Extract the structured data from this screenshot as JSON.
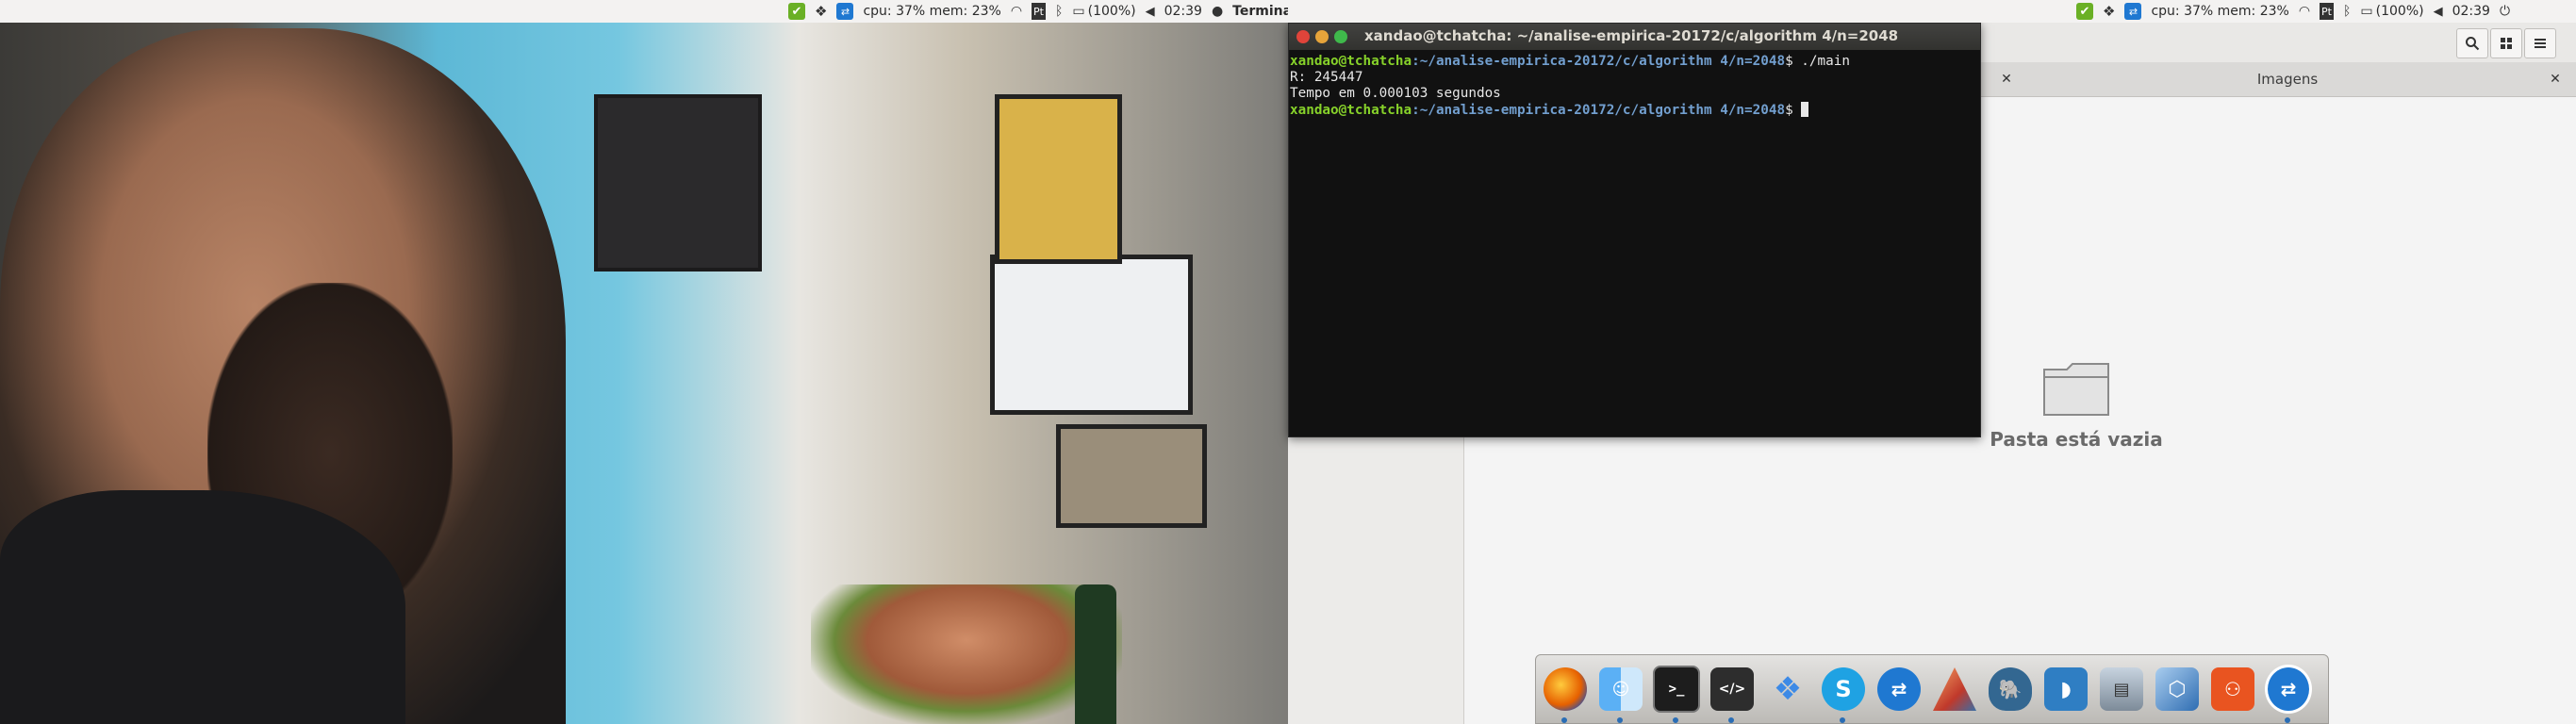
{
  "top_panel": {
    "cpu_mem": "cpu: 37% mem: 23%",
    "keyboard_layout": "Pt",
    "battery": "(100%)",
    "clock": "02:39",
    "app_name": "Terminal"
  },
  "top_panel_right": {
    "cpu_mem": "cpu: 37% mem: 23%",
    "keyboard_layout": "Pt",
    "battery": "(100%)",
    "clock": "02:39"
  },
  "terminal": {
    "title": "xandao@tchatcha: ~/analise-empirica-20172/c/algorithm 4/n=2048",
    "prompt_user": "xandao@tchatcha",
    "prompt_path": ":~/analise-empirica-20172/c/algorithm 4/n=2048",
    "prompt_suffix": "$ ",
    "command": "./main",
    "output_1": "R: 245447",
    "output_2": "Tempo em 0.000103 segundos",
    "prompt2_user": "xandao@tchatcha",
    "prompt2_path": ":~/analise-empirica-20172/c/algorithm 4/n=2048",
    "prompt2_suffix": "$ "
  },
  "file_manager": {
    "tab_label": "Imagens",
    "empty_message": "Pasta está vazia"
  },
  "dock": {
    "items": [
      "firefox-icon",
      "finder-icon",
      "terminal-icon",
      "code-editor-icon",
      "dropbox-icon",
      "skype-icon",
      "teamviewer-icon",
      "matlab-icon",
      "postgresql-icon",
      "mysql-workbench-icon",
      "scanner-icon",
      "virtualbox-icon",
      "ubuntu-software-icon",
      "teamviewer-2-icon"
    ]
  },
  "colors": {
    "prompt_user": "#87d22a",
    "prompt_path": "#729fcf",
    "terminal_bg": "#111111",
    "close": "#e0443a",
    "minimize": "#e6a43a",
    "maximize": "#3fb94b"
  }
}
